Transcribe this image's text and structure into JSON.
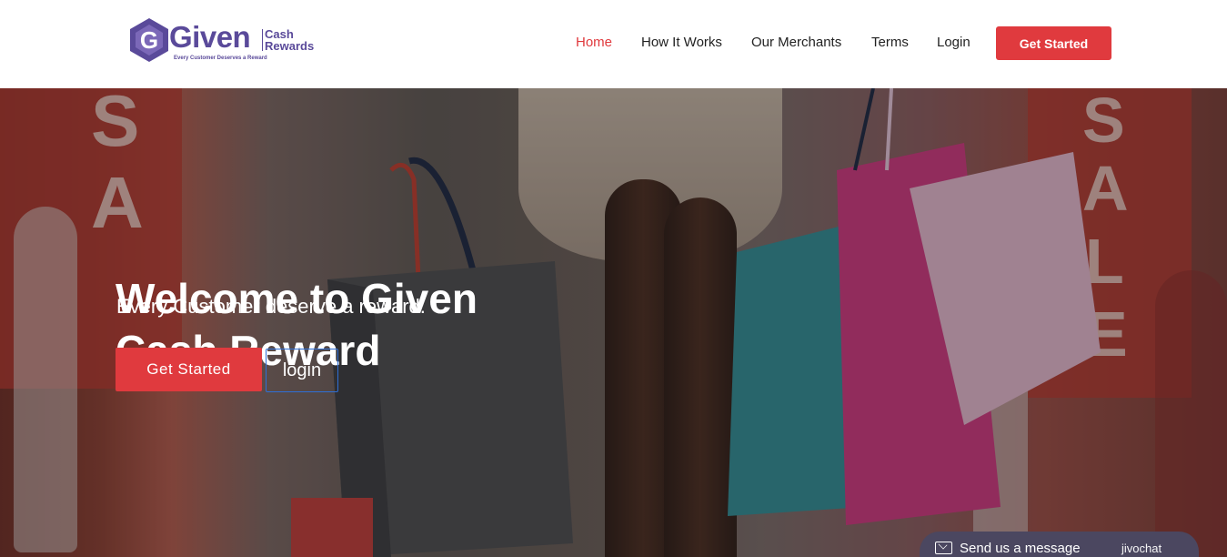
{
  "brand": {
    "logo_letter": "G",
    "logo_word": "Given",
    "logo_cash": "Cash",
    "logo_rewards": "Rewards",
    "logo_tagline": "Every Customer Deserves a Reward",
    "color": "#5a4a9a"
  },
  "nav": {
    "items": [
      {
        "label": "Home",
        "active": true
      },
      {
        "label": "How It Works",
        "active": false
      },
      {
        "label": "Our Merchants",
        "active": false
      },
      {
        "label": "Terms",
        "active": false
      },
      {
        "label": "Login",
        "active": false
      }
    ],
    "cta": "Get Started"
  },
  "hero": {
    "title_line1": "Welcome to Given",
    "title_line2": "Cash Reward",
    "subtitle": "Every Customer deserve a reward.",
    "primary_button": "Get Started",
    "secondary_button": "login",
    "sign_letters_left": [
      "S",
      "A"
    ],
    "sign_letters_right": [
      "S",
      "A",
      "L",
      "E"
    ]
  },
  "chat": {
    "label": "Send us a message",
    "brand": "jivochat",
    "icon": "mail-icon"
  },
  "colors": {
    "accent": "#e03a3e",
    "brand": "#5a4a9a",
    "chat_bg": "#4b4760",
    "outline_button": "#2f6fd6"
  }
}
